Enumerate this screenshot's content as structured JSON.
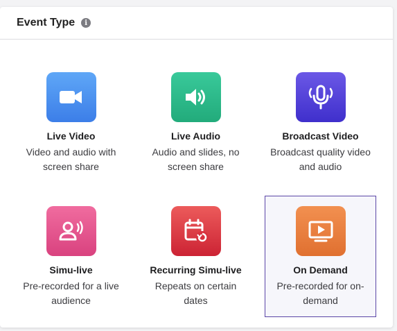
{
  "header": {
    "title": "Event Type",
    "info_icon": "info-icon"
  },
  "cards": [
    {
      "title": "Live Video",
      "description": "Video and audio with screen share",
      "icon": "video-camera-icon",
      "colors": [
        "#5fa7f7",
        "#3c7ee8"
      ],
      "selected": false
    },
    {
      "title": "Live Audio",
      "description": "Audio and slides, no screen share",
      "icon": "speaker-icon",
      "colors": [
        "#39c99a",
        "#22ab7b"
      ],
      "selected": false
    },
    {
      "title": "Broadcast Video",
      "description": "Broadcast quality video and audio",
      "icon": "microphone-icon",
      "colors": [
        "#6b58e6",
        "#3f2fcc"
      ],
      "selected": false
    },
    {
      "title": "Simu-live",
      "description": "Pre-recorded for a live audience",
      "icon": "user-broadcast-icon",
      "colors": [
        "#f06c9f",
        "#d9427f"
      ],
      "selected": false
    },
    {
      "title": "Recurring Simu-live",
      "description": "Repeats on certain dates",
      "icon": "calendar-repeat-icon",
      "colors": [
        "#ec5b5b",
        "#cc2334"
      ],
      "selected": false
    },
    {
      "title": "On Demand",
      "description": "Pre-recorded for on-demand",
      "icon": "play-screen-icon",
      "colors": [
        "#f29050",
        "#e07030"
      ],
      "selected": true
    }
  ]
}
